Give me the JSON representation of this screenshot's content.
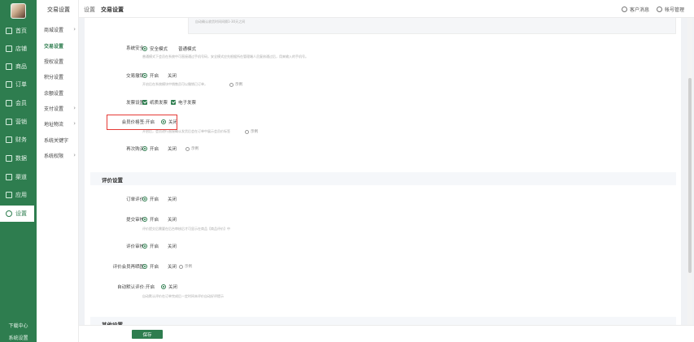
{
  "nav": {
    "items": [
      {
        "label": "首页",
        "icon": "home-icon"
      },
      {
        "label": "店铺",
        "icon": "store-icon"
      },
      {
        "label": "商品",
        "icon": "goods-icon"
      },
      {
        "label": "订单",
        "icon": "order-icon"
      },
      {
        "label": "会员",
        "icon": "member-icon"
      },
      {
        "label": "营销",
        "icon": "marketing-icon"
      },
      {
        "label": "财务",
        "icon": "finance-icon"
      },
      {
        "label": "数据",
        "icon": "data-icon"
      },
      {
        "label": "渠道",
        "icon": "channel-icon"
      },
      {
        "label": "应用",
        "icon": "apps-icon"
      },
      {
        "label": "设置",
        "icon": "settings-icon"
      }
    ],
    "footer": [
      "下载中心",
      "系统设置"
    ]
  },
  "submenu": {
    "title": "交易设置",
    "items": [
      {
        "label": "商城设置",
        "chevron": "›"
      },
      {
        "label": "交易设置",
        "chevron": ""
      },
      {
        "label": "授权设置",
        "chevron": ""
      },
      {
        "label": "积分设置",
        "chevron": ""
      },
      {
        "label": "余额设置",
        "chevron": ""
      },
      {
        "label": "支付设置",
        "chevron": "›"
      },
      {
        "label": "地址物流",
        "chevron": "›"
      },
      {
        "label": "系统关键字",
        "chevron": ""
      },
      {
        "label": "系统权限",
        "chevron": "›"
      }
    ]
  },
  "topbar": {
    "crumb_parent": "设置",
    "crumb_current": "交易设置",
    "messages": "客户消息",
    "account": "帐号管理"
  },
  "content": {
    "top_hint": "自动确认收货时间间隔1-30天之间",
    "rows": [
      {
        "label": "系统安全:",
        "options": [
          "安全模式",
          "普通模式"
        ],
        "desc": "普通模式下会员在系统中可直接通过手机号码，安全模式应先根据所在管理端人员复核通过后，用来输入的手机号。"
      },
      {
        "label": "交易撤销:",
        "options": [
          "开启",
          "关闭"
        ],
        "desc": "开启后在系统模块中销售员可以撤销已订单，",
        "example": "示例"
      },
      {
        "label": "发票设置:",
        "options": [
          "纸质发票",
          "电子发票"
        ]
      },
      {
        "label": "会员价格签:",
        "options": [
          "开启",
          "关闭"
        ],
        "desc": "开启后，会员进行直接确认发货后会在订单中展示会员价标签",
        "example": "示例"
      },
      {
        "label": "再次购买:",
        "options": [
          "开启",
          "关闭"
        ],
        "example": "示例"
      }
    ],
    "section_review": "评价设置",
    "review_rows": [
      {
        "label": "订单评价:",
        "options": [
          "开启",
          "关闭"
        ]
      },
      {
        "label": "提交审核:",
        "options": [
          "开启",
          "关闭"
        ],
        "desc": "评价提交后需要在后台审核后才可显示在商品【商品评价】中"
      },
      {
        "label": "评价审核:",
        "options": [
          "开启",
          "关闭"
        ]
      },
      {
        "label": "评价会员再晒图:",
        "options": [
          "开启",
          "关闭"
        ],
        "example": "示例"
      },
      {
        "label": "自动默认评价:",
        "options": [
          "开启",
          "关闭"
        ],
        "desc": "自动默认评价在订单完成后一定时间未评价自动好评提示"
      }
    ],
    "section_other": "其他设置"
  },
  "footer": {
    "save_label": "保存"
  },
  "colors": {
    "primary": "#2e7d4f",
    "highlight": "#e53935"
  }
}
